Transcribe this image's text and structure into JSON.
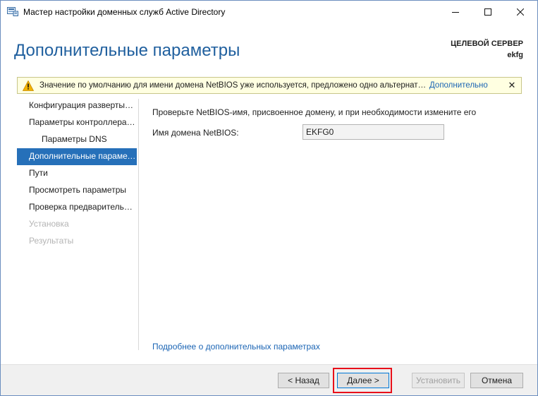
{
  "window": {
    "title": "Мастер настройки доменных служб Active Directory",
    "controls": {
      "minimize": "—",
      "maximize": "☐",
      "close": "✕"
    }
  },
  "header": {
    "title": "Дополнительные параметры",
    "target_label": "ЦЕЛЕВОЙ СЕРВЕР",
    "target_name": "ekfg"
  },
  "warning": {
    "text": "Значение по умолчанию для имени домена NetBIOS уже используется, предложено одно альтернативное.",
    "more_link": "Дополнительно",
    "close": "✕"
  },
  "sidebar": {
    "items": [
      {
        "label": "Конфигурация развертывания"
      },
      {
        "label": "Параметры контроллера домена"
      },
      {
        "label": "Параметры DNS"
      },
      {
        "label": "Дополнительные параметры"
      },
      {
        "label": "Пути"
      },
      {
        "label": "Просмотреть параметры"
      },
      {
        "label": "Проверка предварительных требований"
      },
      {
        "label": "Установка"
      },
      {
        "label": "Результаты"
      }
    ]
  },
  "main": {
    "description": "Проверьте NetBIOS-имя, присвоенное домену, и при необходимости измените его",
    "netbios_label": "Имя домена NetBIOS:",
    "netbios_value": "EKFG0",
    "more_link": "Подробнее о дополнительных параметрах"
  },
  "footer": {
    "back": "< Назад",
    "next": "Далее >",
    "install": "Установить",
    "cancel": "Отмена"
  },
  "colors": {
    "accent": "#2670b9",
    "title": "#1f5f9e",
    "link": "#1a64b4",
    "warning_bg": "#ffffe1",
    "highlight": "#e8101a"
  }
}
